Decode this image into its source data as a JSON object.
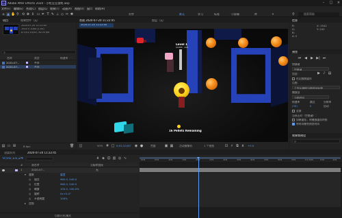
{
  "app": {
    "title": "Adobe After Effects 2020 - 小吃豆豆游戏.aep",
    "logo": "Ae"
  },
  "menu": [
    "文件(F)",
    "编辑(E)",
    "合成(C)",
    "图层(L)",
    "效果(T)",
    "动画(A)",
    "视图(V)",
    "窗口",
    "帮助(H)"
  ],
  "toolbar": {
    "tools": [
      "home-icon",
      "selection-icon",
      "hand-icon",
      "zoom-icon",
      "orbit-icon",
      "pan-icon",
      "dolly-icon",
      "rect-icon",
      "pen-icon",
      "text-icon",
      "brush-icon",
      "stamp-icon",
      "eraser-icon",
      "roto-icon",
      "puppet-icon"
    ],
    "snap_label": "对齐",
    "workspaces": [
      "默认",
      "学习",
      "标准",
      "小屏幕",
      "库"
    ],
    "search_placeholder": "搜索帮助"
  },
  "project": {
    "tabs": [
      "项目",
      "效果控件（无）"
    ],
    "meta": [
      "2020-07-20 11:22:45",
      "1920 x 1080 (1.00)",
      "Δ 0;01;10;00, 30.00 fps"
    ],
    "search_placeholder": "",
    "columns": [
      "名称",
      "类型",
      "帧速率"
    ],
    "items": [
      {
        "name": "2020-07...",
        "type": "合成",
        "color": "#c3b6ff"
      },
      {
        "name": "2020-07...",
        "type": "合成",
        "color": "#c3b6ff"
      }
    ],
    "bpc": "8 bpc"
  },
  "viewer": {
    "tabs": [
      "合成 2020-07-20 11:22:45",
      "图层（无）"
    ],
    "breadcrumb": "2020-07-20 11:22:45",
    "hud_level": "Level 1",
    "hud_score": "Score: 300",
    "pellets_text": "16 Pellets Remaining",
    "zoom": "50%",
    "timecode": "0;01;10;00",
    "resolution": "完整",
    "camera": "活动摄像机",
    "views": "1 个视图",
    "exposure": "+0.0"
  },
  "info_panel": {
    "title": "信息",
    "values": [
      "R:",
      "G:",
      "B:",
      "A: 0",
      "X: 1542",
      "Y: 252"
    ]
  },
  "preview_panel": {
    "title": "预览",
    "shortcut_label": "快捷键",
    "shortcut_value": "空格键",
    "include_label": "包含：",
    "cache_label": "在回放前缓存",
    "range_label": "范围",
    "range_value": "工作区域按当前时间延伸",
    "play_from_label": "播放自",
    "play_from_value": "当前时间",
    "frame_rate_label": "帧速率",
    "skip_label": "跳过",
    "resolution_label": "分辨率",
    "frame_rate_value": "(30)",
    "skip_value": "0",
    "resolution_value": "自动",
    "fullscreen_label": "全屏",
    "stop_label": "当停止时（空格键）：",
    "if_cache_label": "如果缓存，则播放缓存的帧",
    "move_time_label": "将时间移到预览时间",
    "effects_title": "效果和预设",
    "effects_search": ""
  },
  "timeline": {
    "tabs": [
      "渲染队列",
      "2020-07-20 11:22:45"
    ],
    "timecode": "0;01;11;24",
    "timecode_sub": "02154 (30.00 fps)",
    "col_headers": [
      "#",
      "源名称",
      "父级和链接"
    ],
    "layer": {
      "index": "1",
      "name": "2020-07...",
      "parent": "无"
    },
    "transform_label": "变换",
    "reset_label": "重置",
    "properties": [
      {
        "name": "锚点",
        "value": "960.0, 540.0"
      },
      {
        "name": "位置",
        "value": "960.0, 540.0"
      },
      {
        "name": "缩放",
        "value": "100.0, 100.0%"
      },
      {
        "name": "旋转",
        "value": "0x+0.0°"
      },
      {
        "name": "不透明度",
        "value": "100%"
      }
    ],
    "audio_label": "音频",
    "ruler": [
      "00s",
      "05s",
      "10s",
      "15s",
      "20s",
      "25s",
      "30s",
      "35s",
      "40s",
      "45s",
      "50s",
      "55s",
      "01:00s",
      "05s",
      "10s"
    ],
    "toggle_label": "切换开关/模式"
  },
  "colors": {
    "accent": "#5b9cf2",
    "maze_blue": "#2542b8",
    "pellet_orange": "#f28a18",
    "pacman_yellow": "#ffd21e"
  }
}
